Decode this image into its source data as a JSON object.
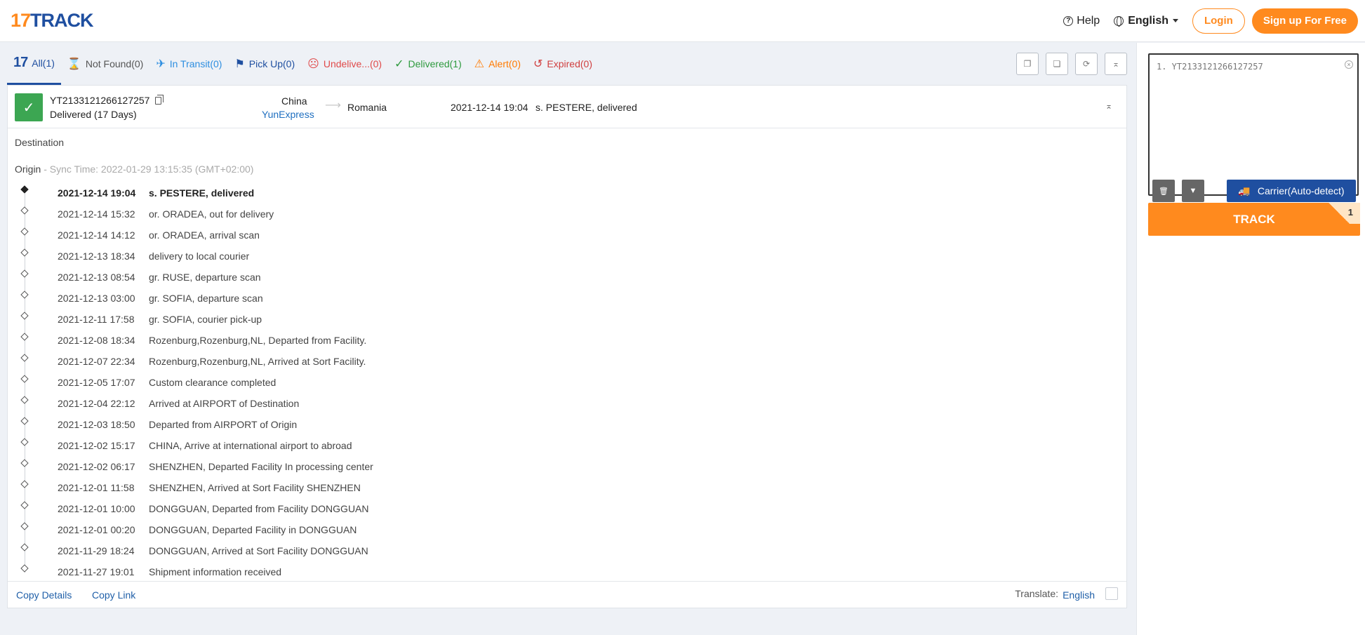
{
  "header": {
    "logo_num": "17",
    "logo_name": "TRACK",
    "help": "Help",
    "language": "English",
    "login": "Login",
    "signup": "Sign up For Free"
  },
  "tabs": [
    {
      "label": "All(1)",
      "icon": "17-logo-icon"
    },
    {
      "label": "Not Found(0)",
      "icon": "hourglass-icon"
    },
    {
      "label": "In Transit(0)",
      "icon": "plane-icon"
    },
    {
      "label": "Pick Up(0)",
      "icon": "flag-icon"
    },
    {
      "label": "Undelive...(0)",
      "icon": "sad-face-icon"
    },
    {
      "label": "Delivered(1)",
      "icon": "checkmark-icon"
    },
    {
      "label": "Alert(0)",
      "icon": "warning-icon"
    },
    {
      "label": "Expired(0)",
      "icon": "clock-history-icon"
    }
  ],
  "parcel": {
    "tracking_number": "YT2133121266127257",
    "status": "Delivered (17 Days)",
    "origin_country": "China",
    "carrier": "YunExpress",
    "destination_country": "Romania",
    "latest_time": "2021-12-14 19:04",
    "latest_event": "s. PESTERE, delivered"
  },
  "sections": {
    "destination": "Destination",
    "origin": "Origin",
    "sync_time": " - Sync Time: 2022-01-29 13:15:35 (GMT+02:00)"
  },
  "events": [
    {
      "time": "2021-12-14 19:04",
      "desc": "s. PESTERE, delivered"
    },
    {
      "time": "2021-12-14 15:32",
      "desc": "or. ORADEA, out for delivery"
    },
    {
      "time": "2021-12-14 14:12",
      "desc": "or. ORADEA, arrival scan"
    },
    {
      "time": "2021-12-13 18:34",
      "desc": "delivery to local courier"
    },
    {
      "time": "2021-12-13 08:54",
      "desc": "gr. RUSE, departure scan"
    },
    {
      "time": "2021-12-13 03:00",
      "desc": "gr. SOFIA, departure scan"
    },
    {
      "time": "2021-12-11 17:58",
      "desc": "gr. SOFIA, courier pick-up"
    },
    {
      "time": "2021-12-08 18:34",
      "desc": "Rozenburg,Rozenburg,NL, Departed from Facility."
    },
    {
      "time": "2021-12-07 22:34",
      "desc": "Rozenburg,Rozenburg,NL, Arrived at Sort Facility."
    },
    {
      "time": "2021-12-05 17:07",
      "desc": "Custom clearance completed"
    },
    {
      "time": "2021-12-04 22:12",
      "desc": "Arrived at AIRPORT of Destination"
    },
    {
      "time": "2021-12-03 18:50",
      "desc": "Departed from AIRPORT of Origin"
    },
    {
      "time": "2021-12-02 15:17",
      "desc": "CHINA, Arrive at international airport to abroad"
    },
    {
      "time": "2021-12-02 06:17",
      "desc": "SHENZHEN, Departed Facility In processing center"
    },
    {
      "time": "2021-12-01 11:58",
      "desc": "SHENZHEN, Arrived at Sort Facility SHENZHEN"
    },
    {
      "time": "2021-12-01 10:00",
      "desc": "DONGGUAN, Departed from Facility DONGGUAN"
    },
    {
      "time": "2021-12-01 00:20",
      "desc": "DONGGUAN, Departed Facility in DONGGUAN"
    },
    {
      "time": "2021-11-29 18:24",
      "desc": "DONGGUAN, Arrived at Sort Facility DONGGUAN"
    },
    {
      "time": "2021-11-27 19:01",
      "desc": "Shipment information received"
    }
  ],
  "footer": {
    "copy_details": "Copy Details",
    "copy_link": "Copy Link",
    "translate_label": "Translate:",
    "translate_language": "English"
  },
  "sidebar": {
    "entry": "1. YT2133121266127257",
    "carrier_button": "Carrier(Auto-detect)",
    "track_button": "TRACK",
    "track_count": "1"
  },
  "colors": {
    "brand_orange": "#ff8a1e",
    "brand_blue": "#1f4fa0",
    "delivered_green": "#3ca652"
  }
}
